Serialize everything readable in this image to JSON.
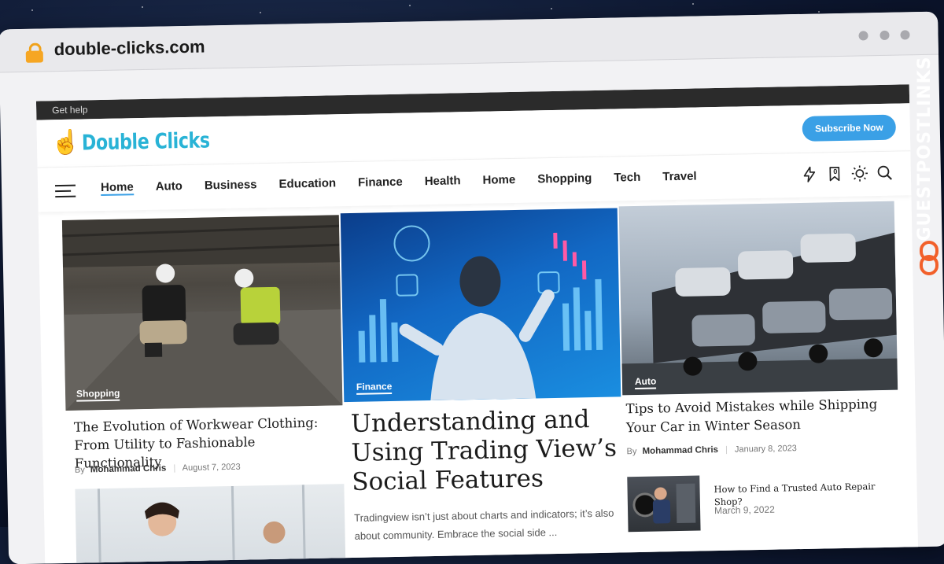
{
  "browser": {
    "url": "double-clicks.com"
  },
  "topbar": {
    "help": "Get help"
  },
  "header": {
    "logo_text": "Double Clicks",
    "subscribe_label": "Subscribe Now"
  },
  "nav": {
    "items": [
      "Home",
      "Auto",
      "Business",
      "Education",
      "Finance",
      "Health",
      "Home",
      "Shopping",
      "Tech",
      "Travel"
    ],
    "icons": [
      "lightning-icon",
      "bookmark-icon",
      "sun-icon",
      "search-icon"
    ],
    "bookmark_count": "0"
  },
  "articles": [
    {
      "category": "Shopping",
      "title": "The Evolution of Workwear Clothing: From Utility to Fashionable Functionality",
      "by": "By",
      "author": "Mohammad Chris",
      "date": "August 7, 2023"
    },
    {
      "category": "Finance",
      "title": "Understanding and Using Trading View’s Social Features",
      "excerpt": "Tradingview isn’t just about charts and indicators; it’s also about community. Embrace the social side ..."
    },
    {
      "category": "Auto",
      "title": "Tips to Avoid Mistakes while Shipping Your Car in Winter Season",
      "by": "By",
      "author": "Mohammad Chris",
      "date": "January 8, 2023"
    },
    {
      "title": "How to Find a Trusted Auto Repair Shop?",
      "date": "March 9, 2022"
    }
  ],
  "watermark": {
    "text": "GUESTPOSTLINKS"
  }
}
